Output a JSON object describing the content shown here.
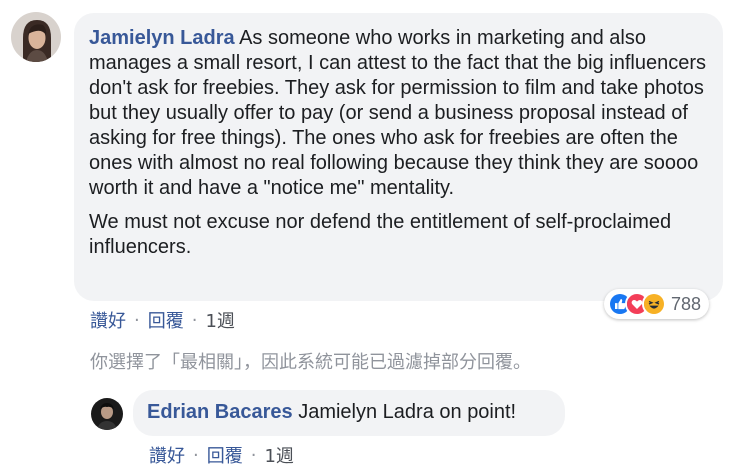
{
  "comment": {
    "author": "Jamielyn Ladra",
    "paragraphs": [
      "As someone who works in marketing and also manages a small resort, I can attest to the fact that the big influencers don't ask for freebies. They ask for permission to film and take photos but they usually offer to pay (or send a business proposal instead of asking for free things). The ones who ask for freebies are often the ones with almost no real following because they think they are soooo worth it and have a \"notice me\" mentality.",
      "We must not excuse nor defend the entitlement of self-proclaimed influencers."
    ],
    "reactions": {
      "icons": [
        "like-icon",
        "love-icon",
        "haha-icon"
      ],
      "count": "788"
    },
    "actions": {
      "like": "讚好",
      "reply": "回覆",
      "time": "1週"
    }
  },
  "filter_notice": "你選擇了「最相關」，因此系統可能已過濾掉部分回覆。",
  "reply": {
    "author": "Edrian Bacares",
    "text": "Jamielyn Ladra on point!",
    "actions": {
      "like": "讚好",
      "reply": "回覆",
      "time": "1週"
    }
  },
  "colors": {
    "author": "#385898",
    "bubble": "#f2f3f5",
    "meta": "#90949c",
    "like_blue": "#1877f2",
    "love_red": "#f33e58",
    "haha_yellow": "#f7b125"
  }
}
